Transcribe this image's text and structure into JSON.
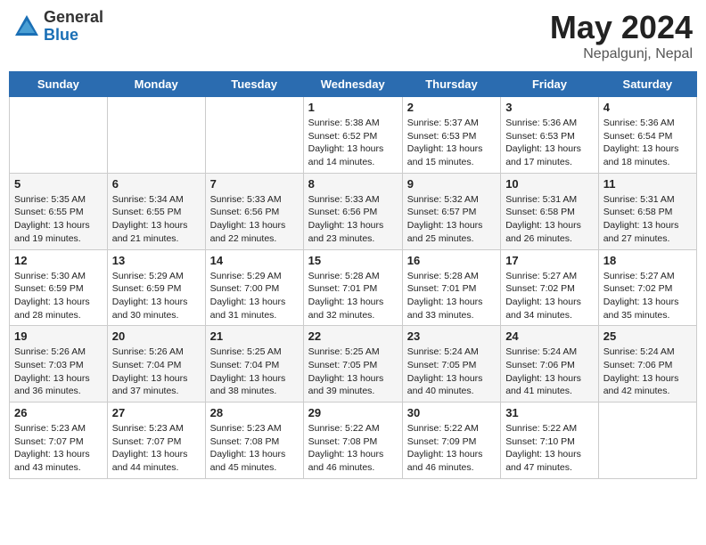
{
  "header": {
    "logo_general": "General",
    "logo_blue": "Blue",
    "month_year": "May 2024",
    "location": "Nepalgunj, Nepal"
  },
  "days_of_week": [
    "Sunday",
    "Monday",
    "Tuesday",
    "Wednesday",
    "Thursday",
    "Friday",
    "Saturday"
  ],
  "weeks": [
    [
      {
        "day": "",
        "content": ""
      },
      {
        "day": "",
        "content": ""
      },
      {
        "day": "",
        "content": ""
      },
      {
        "day": "1",
        "content": "Sunrise: 5:38 AM\nSunset: 6:52 PM\nDaylight: 13 hours and 14 minutes."
      },
      {
        "day": "2",
        "content": "Sunrise: 5:37 AM\nSunset: 6:53 PM\nDaylight: 13 hours and 15 minutes."
      },
      {
        "day": "3",
        "content": "Sunrise: 5:36 AM\nSunset: 6:53 PM\nDaylight: 13 hours and 17 minutes."
      },
      {
        "day": "4",
        "content": "Sunrise: 5:36 AM\nSunset: 6:54 PM\nDaylight: 13 hours and 18 minutes."
      }
    ],
    [
      {
        "day": "5",
        "content": "Sunrise: 5:35 AM\nSunset: 6:55 PM\nDaylight: 13 hours and 19 minutes."
      },
      {
        "day": "6",
        "content": "Sunrise: 5:34 AM\nSunset: 6:55 PM\nDaylight: 13 hours and 21 minutes."
      },
      {
        "day": "7",
        "content": "Sunrise: 5:33 AM\nSunset: 6:56 PM\nDaylight: 13 hours and 22 minutes."
      },
      {
        "day": "8",
        "content": "Sunrise: 5:33 AM\nSunset: 6:56 PM\nDaylight: 13 hours and 23 minutes."
      },
      {
        "day": "9",
        "content": "Sunrise: 5:32 AM\nSunset: 6:57 PM\nDaylight: 13 hours and 25 minutes."
      },
      {
        "day": "10",
        "content": "Sunrise: 5:31 AM\nSunset: 6:58 PM\nDaylight: 13 hours and 26 minutes."
      },
      {
        "day": "11",
        "content": "Sunrise: 5:31 AM\nSunset: 6:58 PM\nDaylight: 13 hours and 27 minutes."
      }
    ],
    [
      {
        "day": "12",
        "content": "Sunrise: 5:30 AM\nSunset: 6:59 PM\nDaylight: 13 hours and 28 minutes."
      },
      {
        "day": "13",
        "content": "Sunrise: 5:29 AM\nSunset: 6:59 PM\nDaylight: 13 hours and 30 minutes."
      },
      {
        "day": "14",
        "content": "Sunrise: 5:29 AM\nSunset: 7:00 PM\nDaylight: 13 hours and 31 minutes."
      },
      {
        "day": "15",
        "content": "Sunrise: 5:28 AM\nSunset: 7:01 PM\nDaylight: 13 hours and 32 minutes."
      },
      {
        "day": "16",
        "content": "Sunrise: 5:28 AM\nSunset: 7:01 PM\nDaylight: 13 hours and 33 minutes."
      },
      {
        "day": "17",
        "content": "Sunrise: 5:27 AM\nSunset: 7:02 PM\nDaylight: 13 hours and 34 minutes."
      },
      {
        "day": "18",
        "content": "Sunrise: 5:27 AM\nSunset: 7:02 PM\nDaylight: 13 hours and 35 minutes."
      }
    ],
    [
      {
        "day": "19",
        "content": "Sunrise: 5:26 AM\nSunset: 7:03 PM\nDaylight: 13 hours and 36 minutes."
      },
      {
        "day": "20",
        "content": "Sunrise: 5:26 AM\nSunset: 7:04 PM\nDaylight: 13 hours and 37 minutes."
      },
      {
        "day": "21",
        "content": "Sunrise: 5:25 AM\nSunset: 7:04 PM\nDaylight: 13 hours and 38 minutes."
      },
      {
        "day": "22",
        "content": "Sunrise: 5:25 AM\nSunset: 7:05 PM\nDaylight: 13 hours and 39 minutes."
      },
      {
        "day": "23",
        "content": "Sunrise: 5:24 AM\nSunset: 7:05 PM\nDaylight: 13 hours and 40 minutes."
      },
      {
        "day": "24",
        "content": "Sunrise: 5:24 AM\nSunset: 7:06 PM\nDaylight: 13 hours and 41 minutes."
      },
      {
        "day": "25",
        "content": "Sunrise: 5:24 AM\nSunset: 7:06 PM\nDaylight: 13 hours and 42 minutes."
      }
    ],
    [
      {
        "day": "26",
        "content": "Sunrise: 5:23 AM\nSunset: 7:07 PM\nDaylight: 13 hours and 43 minutes."
      },
      {
        "day": "27",
        "content": "Sunrise: 5:23 AM\nSunset: 7:07 PM\nDaylight: 13 hours and 44 minutes."
      },
      {
        "day": "28",
        "content": "Sunrise: 5:23 AM\nSunset: 7:08 PM\nDaylight: 13 hours and 45 minutes."
      },
      {
        "day": "29",
        "content": "Sunrise: 5:22 AM\nSunset: 7:08 PM\nDaylight: 13 hours and 46 minutes."
      },
      {
        "day": "30",
        "content": "Sunrise: 5:22 AM\nSunset: 7:09 PM\nDaylight: 13 hours and 46 minutes."
      },
      {
        "day": "31",
        "content": "Sunrise: 5:22 AM\nSunset: 7:10 PM\nDaylight: 13 hours and 47 minutes."
      },
      {
        "day": "",
        "content": ""
      }
    ]
  ]
}
